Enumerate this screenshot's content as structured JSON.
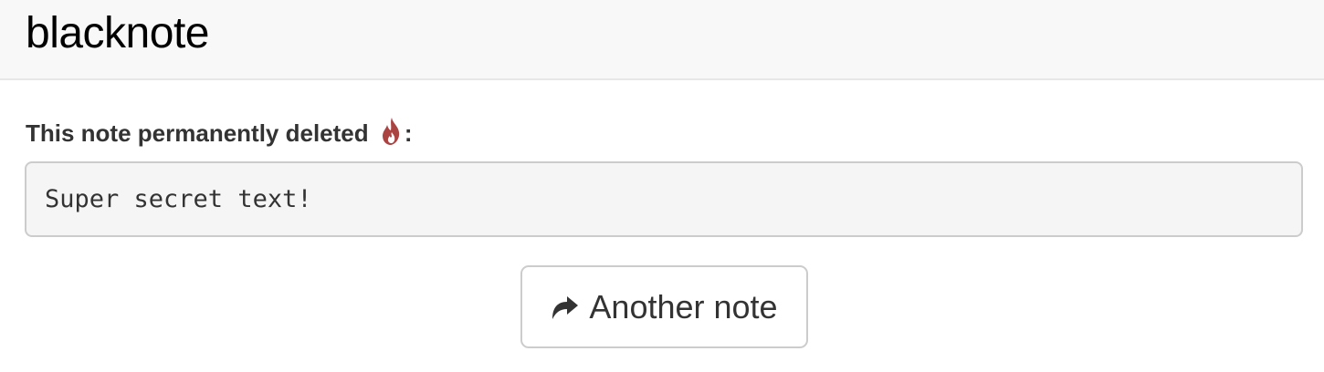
{
  "navbar": {
    "brand": "blacknote"
  },
  "note": {
    "deleted_notice": "This note permanently deleted",
    "notice_suffix": ":",
    "notice_icon": "fire-icon",
    "content": "Super secret text!"
  },
  "actions": {
    "another_note_label": "Another note",
    "another_note_icon": "share-arrow-icon"
  },
  "colors": {
    "navbar_bg": "#f8f8f8",
    "fire_icon": "#a94442",
    "note_bg": "#f5f5f5",
    "border": "#cccccc",
    "text": "#333333"
  }
}
